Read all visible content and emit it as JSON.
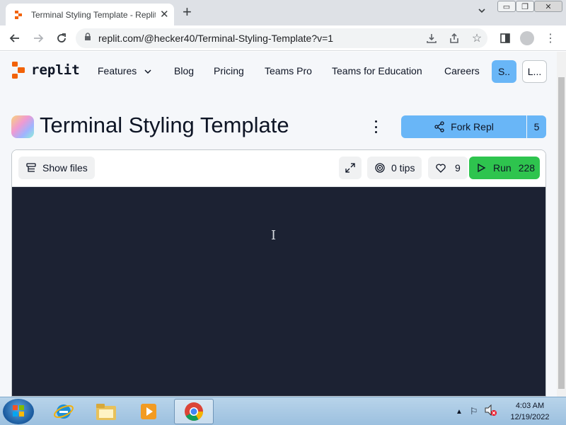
{
  "browser": {
    "tab_title": "Terminal Styling Template - Replit",
    "url": "replit.com/@hecker40/Terminal-Styling-Template?v=1"
  },
  "nav": {
    "logo_text": "replit",
    "items": [
      "Features",
      "Blog",
      "Pricing",
      "Teams Pro",
      "Teams for Education",
      "Careers"
    ],
    "signup_label": "S..",
    "login_label": "L..."
  },
  "repl": {
    "title": "Terminal Styling Template",
    "fork_label": "Fork Repl",
    "fork_count": "5",
    "show_files_label": "Show files",
    "tips_label": "0 tips",
    "likes_count": "9",
    "run_label": "Run",
    "run_count": "228"
  },
  "taskbar": {
    "time": "4:03 AM",
    "date": "12/19/2022"
  },
  "colors": {
    "accent": "#69b6f7",
    "run": "#2ec44e",
    "terminal_bg": "#1c2233",
    "logo_orange": "#f26207"
  }
}
